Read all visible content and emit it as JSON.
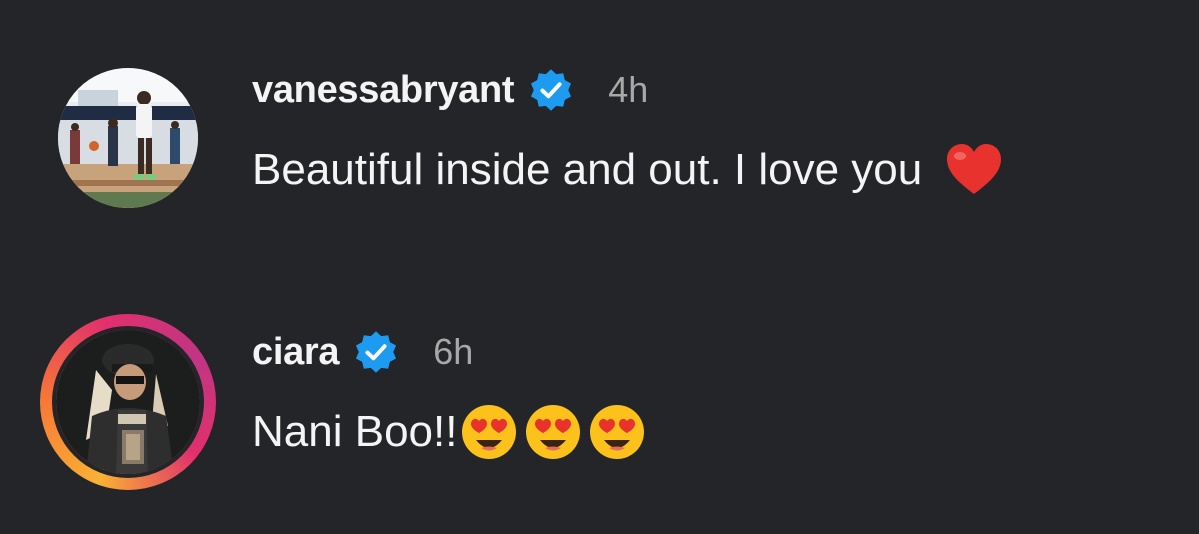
{
  "comments": [
    {
      "username": "vanessabryant",
      "verified": true,
      "timestamp": "4h",
      "text": "Beautiful inside and out. I love you",
      "emoji": [
        "red-heart"
      ],
      "has_story_ring": false
    },
    {
      "username": "ciara",
      "verified": true,
      "timestamp": "6h",
      "text": "Nani Boo!!",
      "emoji": [
        "heart-eyes",
        "heart-eyes",
        "heart-eyes"
      ],
      "has_story_ring": true
    }
  ],
  "colors": {
    "background": "#242529",
    "text": "#f4f4f4",
    "timestamp": "#a8a8a8",
    "verified_badge": "#1d9bf0",
    "heart": "#e8322d"
  }
}
